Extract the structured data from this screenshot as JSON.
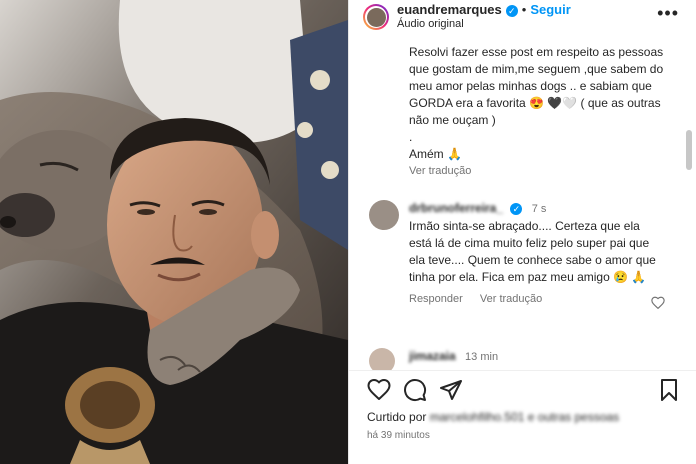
{
  "header": {
    "username": "euandremarques",
    "follow_label": "Seguir",
    "audio": "Áudio original",
    "more_label": "•••"
  },
  "caption": {
    "text": "Resolvi fazer esse post em respeito as pessoas que gostam de mim,me seguem ,que sabem do meu amor pelas minhas dogs .. e sabiam que GORDA era a favorita 😍 🖤🤍 ( que as outras não me ouçam )",
    "dot": ".",
    "amem": "Amém 🙏",
    "see_translation": "Ver tradução"
  },
  "comments": [
    {
      "username": "drbrunoferreira_",
      "time": "7 s",
      "text": "Irmão sinta-se abraçado.... Certeza que ela está lá de cima muito feliz pelo super pai que ela teve.... Quem te conhece sabe o amor que tinha por ela. Fica em paz meu amigo 😢 🙏",
      "reply_label": "Responder",
      "translate_label": "Ver tradução"
    },
    {
      "username": "jimazaia",
      "time": "13 min"
    }
  ],
  "footer": {
    "liked_by_label": "Curtido por",
    "liked_by_names": "marcelohfilho.501 e outras pessoas",
    "time_ago": "há 39 minutos"
  },
  "icons": {
    "like": "heart-icon",
    "comment": "comment-icon",
    "share": "share-icon",
    "save": "bookmark-icon"
  },
  "colors": {
    "accent": "#0095f6",
    "text": "#262626",
    "secondary": "#737373"
  }
}
